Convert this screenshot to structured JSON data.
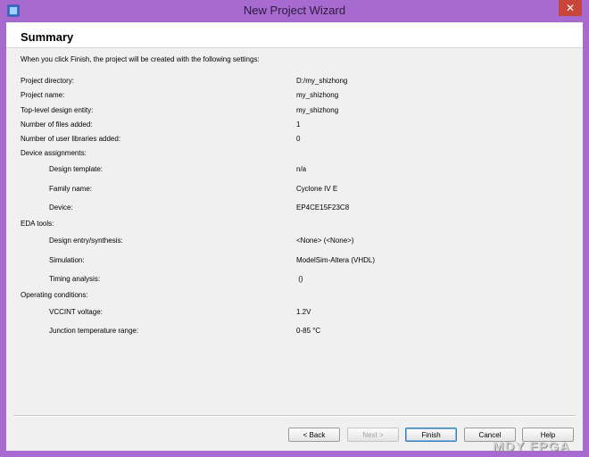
{
  "window": {
    "title": "New Project Wizard",
    "close_label": "✕"
  },
  "page": {
    "heading": "Summary",
    "intro": "When you click Finish, the project will be created with the following settings:"
  },
  "settings": {
    "project_directory": {
      "label": "Project directory:",
      "value": "D:/my_shizhong"
    },
    "project_name": {
      "label": "Project name:",
      "value": "my_shizhong"
    },
    "top_level_entity": {
      "label": "Top-level design entity:",
      "value": "my_shizhong"
    },
    "files_added": {
      "label": "Number of files added:",
      "value": "1"
    },
    "user_libraries_added": {
      "label": "Number of user libraries added:",
      "value": "0"
    },
    "device_assignments": {
      "label": "Device assignments:",
      "design_template": {
        "label": "Design template:",
        "value": "n/a"
      },
      "family_name": {
        "label": "Family name:",
        "value": "Cyclone IV E"
      },
      "device": {
        "label": "Device:",
        "value": "EP4CE15F23C8"
      }
    },
    "eda_tools": {
      "label": "EDA tools:",
      "design_entry": {
        "label": "Design entry/synthesis:",
        "value": "<None> (<None>)"
      },
      "simulation": {
        "label": "Simulation:",
        "value": "ModelSim-Altera (VHDL)"
      },
      "timing_analysis": {
        "label": "Timing analysis:",
        "value": " ()"
      }
    },
    "operating_conditions": {
      "label": "Operating conditions:",
      "vccint": {
        "label": "VCCINT voltage:",
        "value": "1.2V"
      },
      "junction_temp": {
        "label": "Junction temperature range:",
        "value": "0-85 °C"
      }
    }
  },
  "buttons": {
    "back": "< Back",
    "next": "Next >",
    "finish": "Finish",
    "cancel": "Cancel",
    "help": "Help"
  },
  "watermark": "MDY FPGA"
}
